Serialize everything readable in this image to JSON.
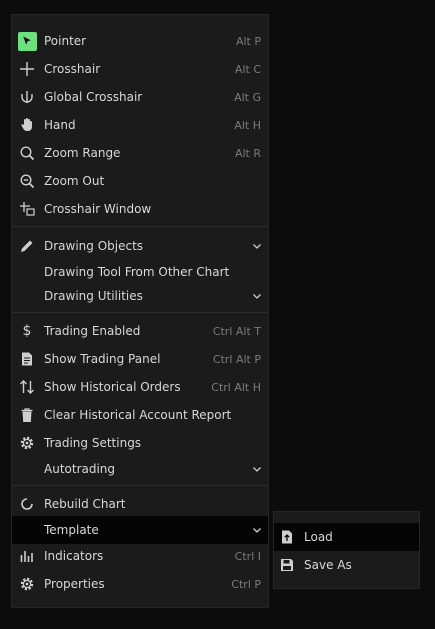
{
  "menu": {
    "items": [
      {
        "label": "Pointer",
        "shortcut": "Alt P",
        "icon": "pointer-icon"
      },
      {
        "label": "Crosshair",
        "shortcut": "Alt C",
        "icon": "crosshair-icon"
      },
      {
        "label": "Global Crosshair",
        "shortcut": "Alt G",
        "icon": "global-crosshair-icon"
      },
      {
        "label": "Hand",
        "shortcut": "Alt H",
        "icon": "hand-icon"
      },
      {
        "label": "Zoom Range",
        "shortcut": "Alt R",
        "icon": "zoom-range-icon"
      },
      {
        "label": "Zoom Out",
        "shortcut": "",
        "icon": "zoom-out-icon"
      },
      {
        "label": "Crosshair Window",
        "shortcut": "",
        "icon": "crosshair-window-icon"
      },
      {
        "label": "Drawing Objects",
        "shortcut": "",
        "icon": "pencil-icon"
      },
      {
        "label": "Drawing Tool From Other Chart",
        "shortcut": "",
        "icon": ""
      },
      {
        "label": "Drawing Utilities",
        "shortcut": "",
        "icon": ""
      },
      {
        "label": "Trading Enabled",
        "shortcut": "Ctrl Alt T",
        "icon": "dollar-icon"
      },
      {
        "label": "Show Trading Panel",
        "shortcut": "Ctrl Alt P",
        "icon": "document-icon"
      },
      {
        "label": "Show Historical Orders",
        "shortcut": "Ctrl Alt H",
        "icon": "up-down-arrows-icon"
      },
      {
        "label": "Clear Historical Account Report",
        "shortcut": "",
        "icon": "trash-icon"
      },
      {
        "label": "Trading Settings",
        "shortcut": "",
        "icon": "gear-icon"
      },
      {
        "label": "Autotrading",
        "shortcut": "",
        "icon": ""
      },
      {
        "label": "Rebuild Chart",
        "shortcut": "",
        "icon": "refresh-icon"
      },
      {
        "label": "Template",
        "shortcut": "",
        "icon": ""
      },
      {
        "label": "Indicators",
        "shortcut": "Ctrl I",
        "icon": "bar-chart-icon"
      },
      {
        "label": "Properties",
        "shortcut": "Ctrl P",
        "icon": "gear-icon"
      }
    ]
  },
  "submenu": {
    "items": [
      {
        "label": "Load",
        "icon": "load-file-icon"
      },
      {
        "label": "Save As",
        "icon": "save-icon"
      }
    ]
  },
  "colors": {
    "accent": "#6fe07e",
    "menu_bg": "#1b1b1b",
    "selected_bg": "#050505",
    "text": "#d8d8d8",
    "shortcut_text": "#7b7b7b"
  }
}
